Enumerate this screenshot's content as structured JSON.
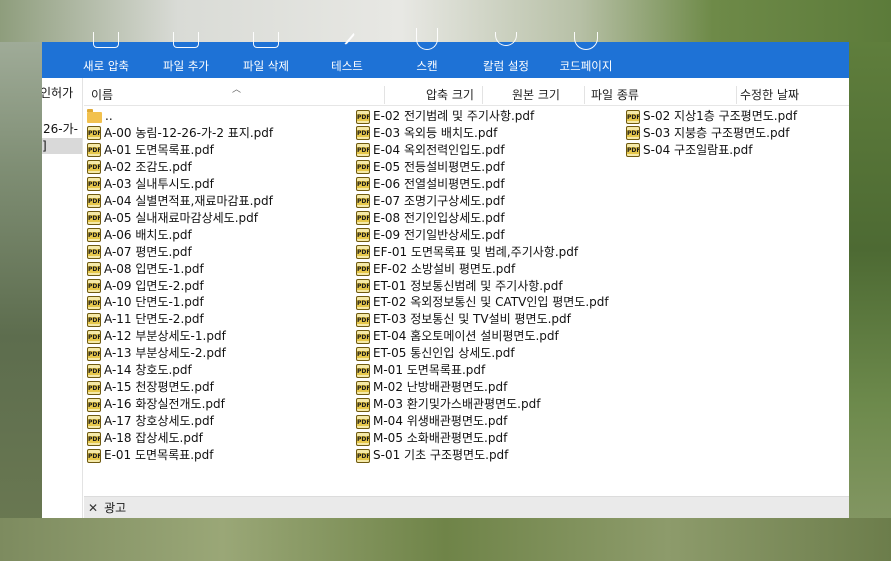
{
  "toolbar": {
    "buttons": [
      {
        "label": "새로 압축",
        "icon": "archive-icon"
      },
      {
        "label": "파일 추가",
        "icon": "add-file-icon"
      },
      {
        "label": "파일 삭제",
        "icon": "delete-file-icon"
      },
      {
        "label": "테스트",
        "icon": "test-icon"
      },
      {
        "label": "스캔",
        "icon": "shield-icon"
      },
      {
        "label": "칼럼 설정",
        "icon": "column-settings-icon"
      },
      {
        "label": "코드페이지",
        "icon": "globe-icon"
      }
    ],
    "color": "#1e72d6"
  },
  "sidebar": {
    "items": [
      "인허가",
      "26-가-",
      "]"
    ]
  },
  "columns": {
    "name": "이름",
    "compressed_size": "압축 크기",
    "original_size": "원본 크기",
    "file_type": "파일 종류",
    "modified": "수정한 날짜"
  },
  "files": {
    "col1": [
      "..",
      "A-00 농림-12-26-가-2 표지.pdf",
      "A-01 도면목록표.pdf",
      "A-02 조감도.pdf",
      "A-03 실내투시도.pdf",
      "A-04 실별면적표,재료마감표.pdf",
      "A-05 실내재료마감상세도.pdf",
      "A-06 배치도.pdf",
      "A-07 평면도.pdf",
      "A-08 입면도-1.pdf",
      "A-09 입면도-2.pdf",
      "A-10 단면도-1.pdf",
      "A-11 단면도-2.pdf",
      "A-12 부분상세도-1.pdf",
      "A-13 부분상세도-2.pdf",
      "A-14 창호도.pdf",
      "A-15 천장평면도.pdf",
      "A-16 화장실전개도.pdf",
      "A-17 창호상세도.pdf",
      "A-18 잡상세도.pdf",
      "E-01 도면목록표.pdf"
    ],
    "col2": [
      "E-02 전기범례 및 주기사항.pdf",
      "E-03 옥외등 배치도.pdf",
      "E-04 옥외전력인입도.pdf",
      "E-05 전등설비평면도.pdf",
      "E-06 전열설비평면도.pdf",
      "E-07 조명기구상세도.pdf",
      "E-08 전기인입상세도.pdf",
      "E-09 전기일반상세도.pdf",
      "EF-01 도면목록표 및 범례,주기사항.pdf",
      "EF-02 소방설비 평면도.pdf",
      "ET-01 정보통신범례 및 주기사항.pdf",
      "ET-02 옥외정보통신 및 CATV인입 평면도.pdf",
      "ET-03 정보통신 및 TV설비 평면도.pdf",
      "ET-04 홈오토메이션 설비평면도.pdf",
      "ET-05 통신인입 상세도.pdf",
      "M-01 도면목록표.pdf",
      "M-02 난방배관평면도.pdf",
      "M-03 환기및가스배관평면도.pdf",
      "M-04 위생배관평면도.pdf",
      "M-05 소화배관평면도.pdf",
      "S-01 기초 구조평면도.pdf"
    ],
    "col3": [
      "S-02 지상1층 구조평면도.pdf",
      "S-03 지붕층 구조평면도.pdf",
      "S-04 구조일람표.pdf"
    ]
  },
  "adbar": {
    "close": "✕",
    "label": "광고"
  }
}
